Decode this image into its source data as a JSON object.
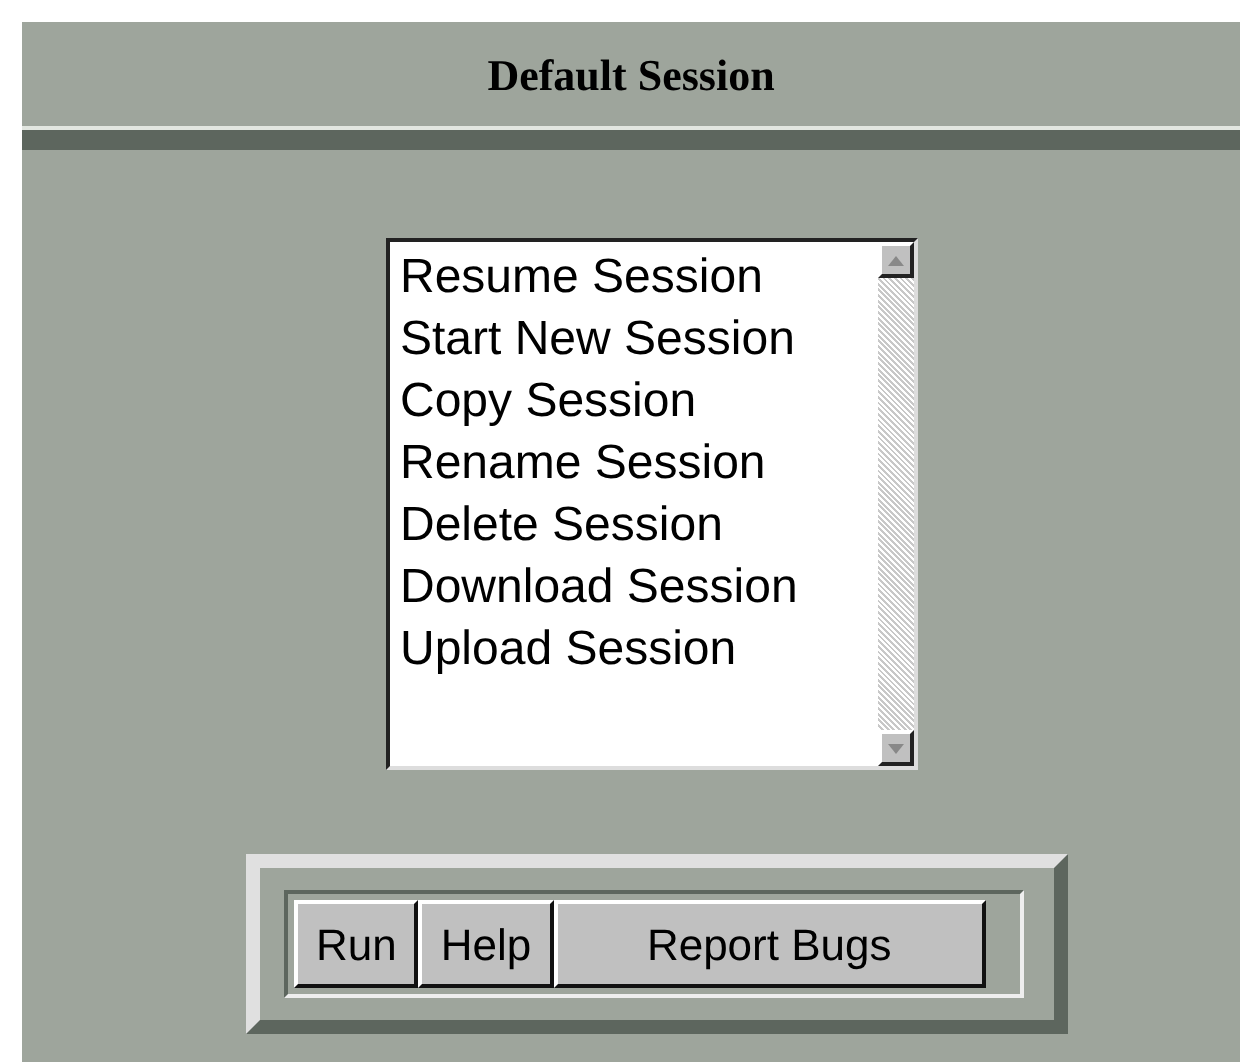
{
  "header": {
    "title": "Default Session"
  },
  "session_list": {
    "items": [
      {
        "label": "Resume Session"
      },
      {
        "label": "Start New Session"
      },
      {
        "label": "Copy Session"
      },
      {
        "label": "Rename Session"
      },
      {
        "label": "Delete Session"
      },
      {
        "label": "Download Session"
      },
      {
        "label": "Upload Session"
      }
    ]
  },
  "buttons": [
    {
      "label": "Run",
      "kind": "small"
    },
    {
      "label": "Help",
      "kind": "small"
    },
    {
      "label": "Report Bugs",
      "kind": "wide"
    }
  ]
}
